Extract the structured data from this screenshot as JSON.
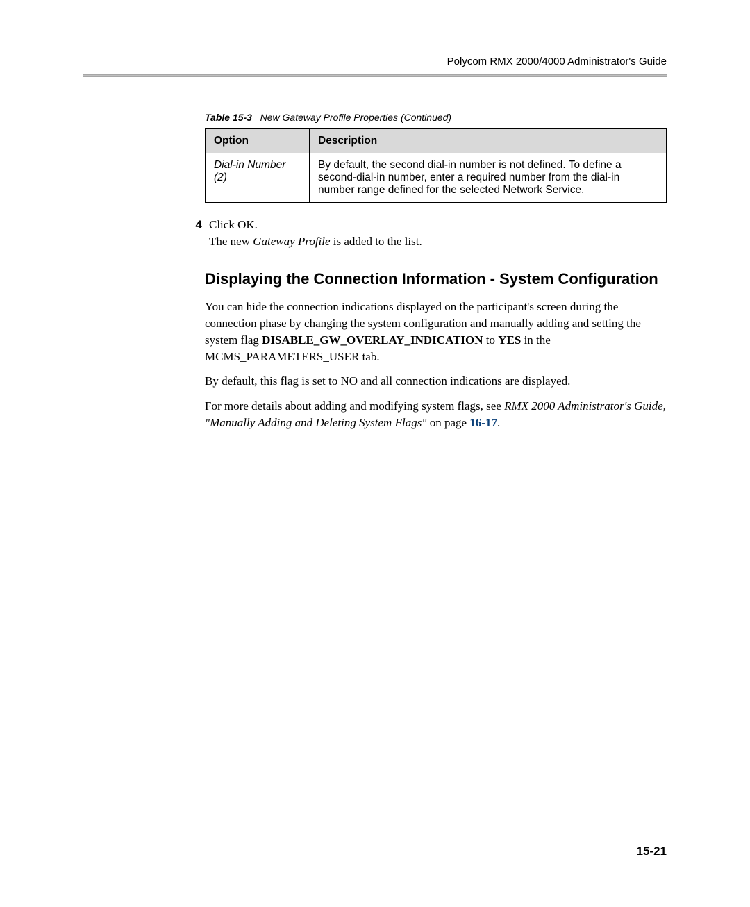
{
  "header": {
    "guide_title": "Polycom RMX 2000/4000 Administrator's Guide"
  },
  "table": {
    "caption_label": "Table 15-3",
    "caption_text": "New Gateway Profile Properties (Continued)",
    "headers": {
      "option": "Option",
      "description": "Description"
    },
    "rows": [
      {
        "option": "Dial-in Number (2)",
        "description": "By default, the second dial-in number is not defined. To define a second-dial-in number, enter a required number from the dial-in number range defined for the selected Network Service."
      }
    ]
  },
  "step": {
    "number": "4",
    "text": "Click OK.",
    "followup_prefix": "The new ",
    "followup_italic": "Gateway Profile",
    "followup_suffix": " is added to the list."
  },
  "section": {
    "heading": "Displaying the Connection Information - System Configuration",
    "para1_prefix": "You can hide the connection indications displayed on the participant's screen during the connection phase by changing the system configuration and manually adding and setting the system flag ",
    "para1_bold1": "DISABLE_GW_OVERLAY_INDICATION",
    "para1_mid1": " to ",
    "para1_bold2": "YES",
    "para1_mid2": " in the MCMS_PARAMETERS_USER tab.",
    "para2": "By default, this flag is set to NO and all connection indications are displayed.",
    "para3_prefix": "For more details about adding and modifying system flags, see ",
    "para3_italic": "RMX 2000 Administrator's Guide, \"Manually Adding and Deleting System Flags\"",
    "para3_suffix": " on page ",
    "para3_pageref": "16-17",
    "para3_period": "."
  },
  "page_number": "15-21"
}
